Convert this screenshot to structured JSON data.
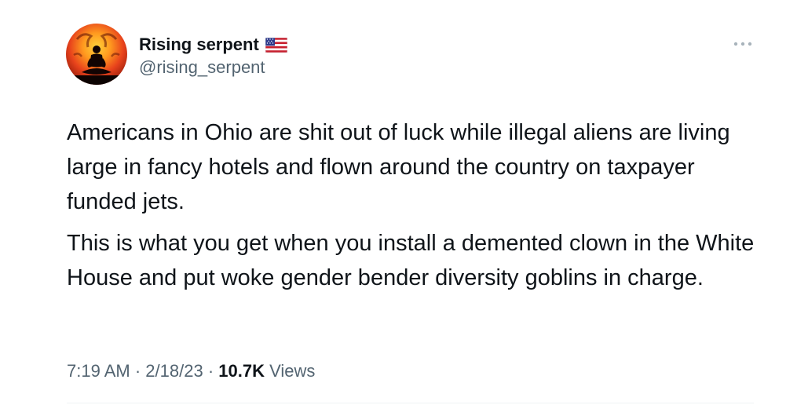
{
  "author": {
    "display_name": "Rising serpent",
    "handle": "@rising_serpent",
    "flag_icon": "us-flag-emoji"
  },
  "tweet": {
    "paragraphs": [
      "Americans in Ohio are shit out of luck while illegal aliens are living large in fancy hotels and flown around the country on taxpayer funded jets.",
      "This is what you get when you install a demented clown in the White House and put woke gender bender diversity goblins in charge."
    ]
  },
  "meta": {
    "time": "7:19 AM",
    "separator": "·",
    "date": "2/18/23",
    "views_count": "10.7K",
    "views_label": "Views"
  },
  "icons": {
    "more": "more-options-icon"
  },
  "colors": {
    "text_primary": "#0f1419",
    "text_secondary": "#536471",
    "divider": "#eff3f4"
  }
}
